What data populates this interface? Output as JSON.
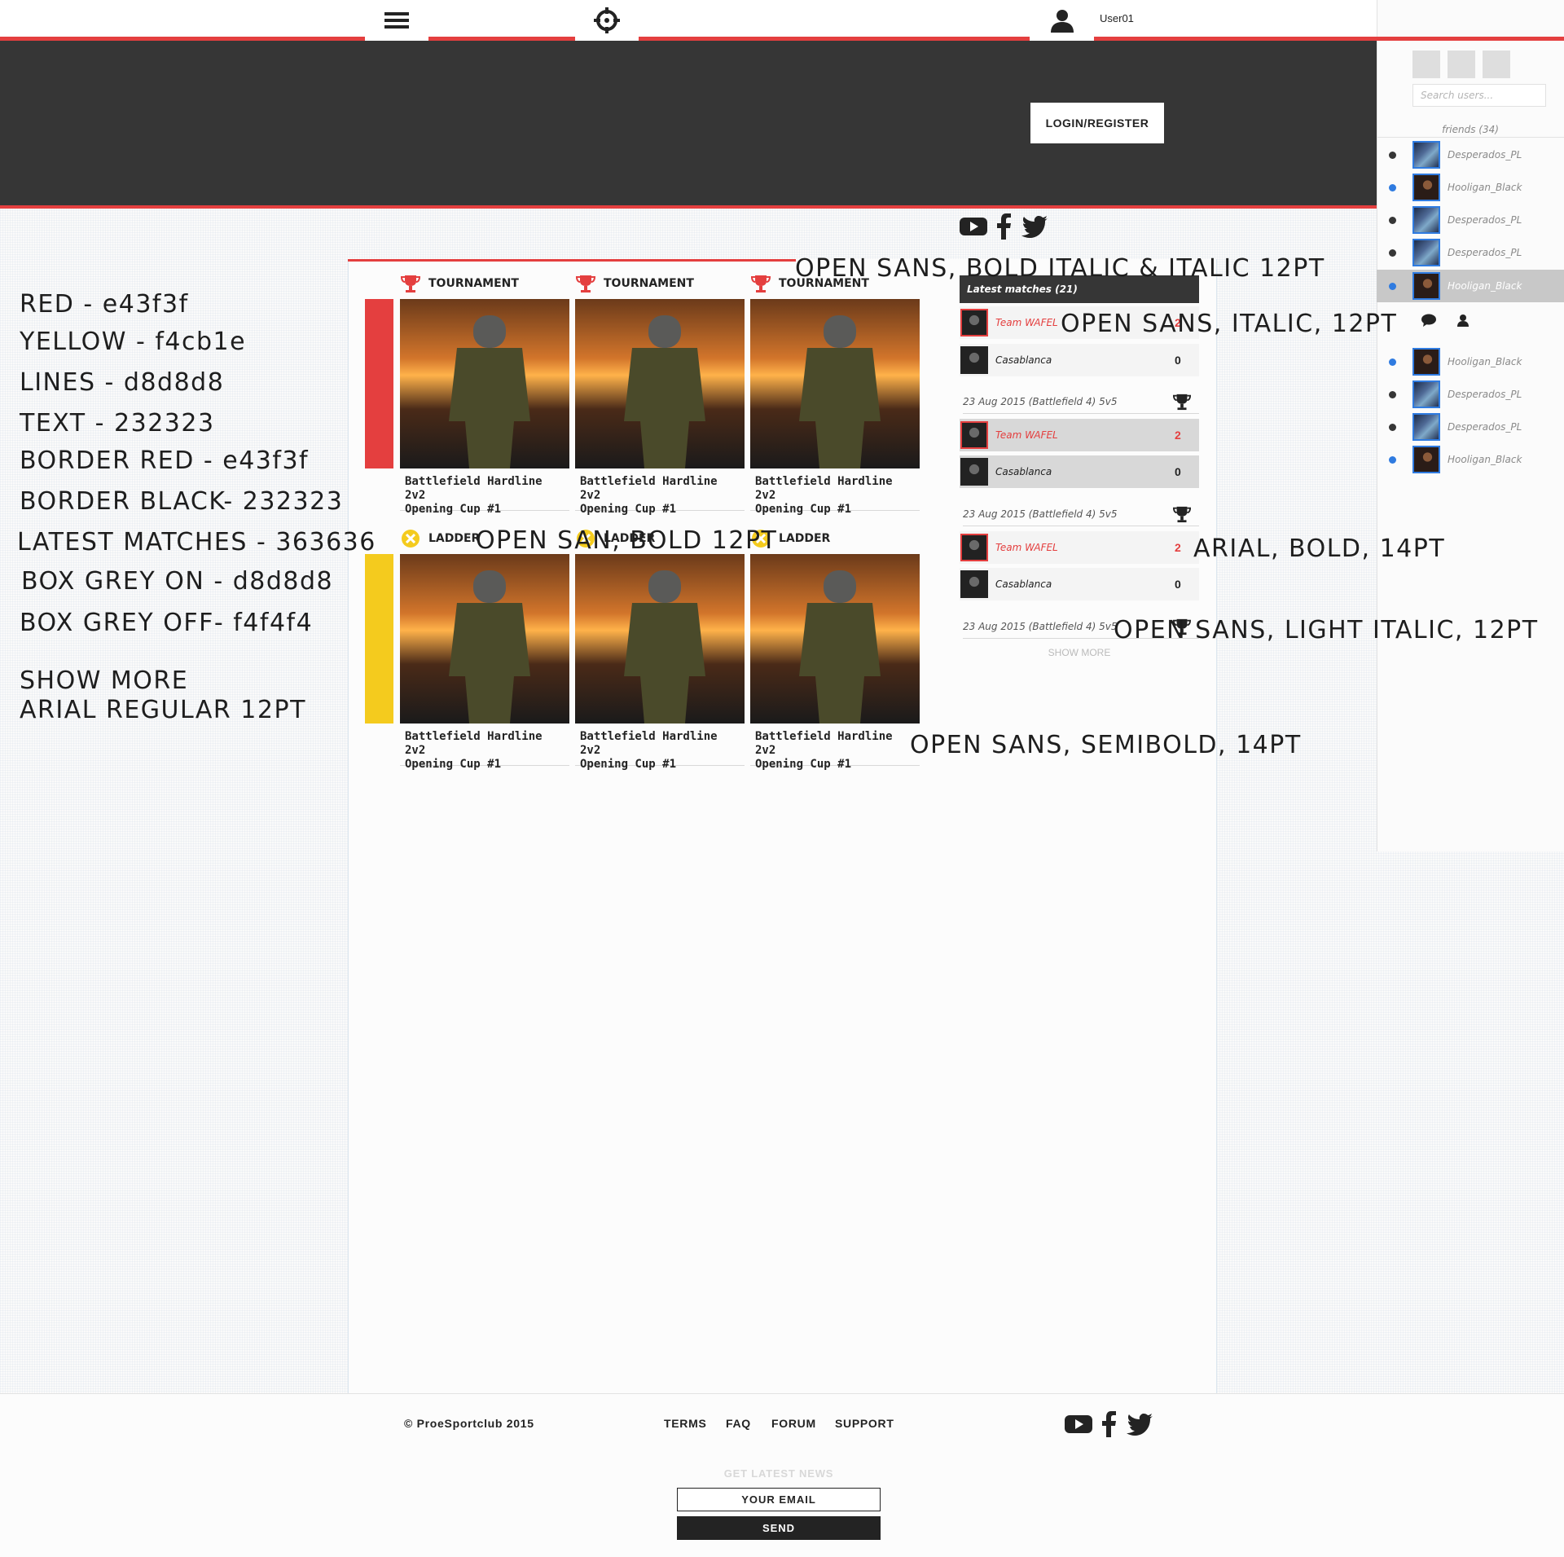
{
  "header": {
    "user_name": "User01",
    "login_label": "LOGIN/REGISTER"
  },
  "social": {
    "icons": [
      "youtube-icon",
      "facebook-icon",
      "twitter-icon"
    ]
  },
  "sidebar": {
    "search_placeholder": "Search users...",
    "friends_title": "friends (34)",
    "friends": [
      {
        "name": "Desperados_PL",
        "status": "offline",
        "active": false
      },
      {
        "name": "Hooligan_Black",
        "status": "online",
        "active": false
      },
      {
        "name": "Desperados_PL",
        "status": "offline",
        "active": false
      },
      {
        "name": "Desperados_PL",
        "status": "offline",
        "active": false
      },
      {
        "name": "Hooligan_Black",
        "status": "online",
        "active": true
      }
    ],
    "friends2": [
      {
        "name": "Hooligan_Black",
        "status": "online"
      },
      {
        "name": "Desperados_PL",
        "status": "offline"
      },
      {
        "name": "Desperados_PL",
        "status": "offline"
      },
      {
        "name": "Hooligan_Black",
        "status": "online"
      }
    ]
  },
  "annotations": {
    "red": "RED - e43f3f",
    "yellow": "YELLOW - f4cb1e",
    "lines": "LINES - d8d8d8",
    "text": "TEXT - 232323",
    "border_red": "BORDER RED - e43f3f",
    "border_black": "BORDER BLACK- 232323",
    "latest_matches": "LATEST MATCHES - 363636",
    "box_grey_on": "BOX GREY ON - d8d8d8",
    "box_grey_off": "BOX GREY OFF- f4f4f4",
    "show_more_1": "SHOW MORE",
    "show_more_2": "ARIAL REGULAR 12PT",
    "open_sans_bold_italic": "OPEN SANS, BOLD ITALIC & ITALIC 12PT",
    "open_sans_italic": "OPEN SANS, ITALIC, 12PT",
    "open_san_bold": "OPEN SAN, BOLD 12PT",
    "arial_bold": "ARIAL, BOLD, 14PT",
    "open_sans_light_italic": "OPEN SANS, LIGHT ITALIC, 12PT",
    "open_sans_semibold": "OPEN SANS, SEMIBOLD, 14PT"
  },
  "cards": {
    "tournament_label": "TOURNAMENT",
    "ladder_label": "LADDER",
    "title_line1": "Battlefield Hardline 2v2",
    "title_line2": "Opening Cup #1"
  },
  "matches": {
    "header": "Latest matches (21)",
    "team_a": "Team WAFEL",
    "team_b": "Casablanca",
    "score_a": "2",
    "score_b": "0",
    "date": "23 Aug 2015 (Battlefield 4) 5v5",
    "show_more": "SHOW MORE"
  },
  "footer": {
    "copyright": "© ProeSportclub 2015",
    "links": [
      "TERMS",
      "FAQ",
      "FORUM",
      "SUPPORT"
    ],
    "news_title": "GET LATEST NEWS",
    "email_placeholder": "YOUR EMAIL",
    "send_label": "SEND"
  },
  "colors": {
    "red": "#e43f3f",
    "yellow": "#f4cb1e",
    "lines": "#d8d8d8",
    "text": "#232323",
    "latest": "#363636",
    "online": "#2f7be0"
  }
}
